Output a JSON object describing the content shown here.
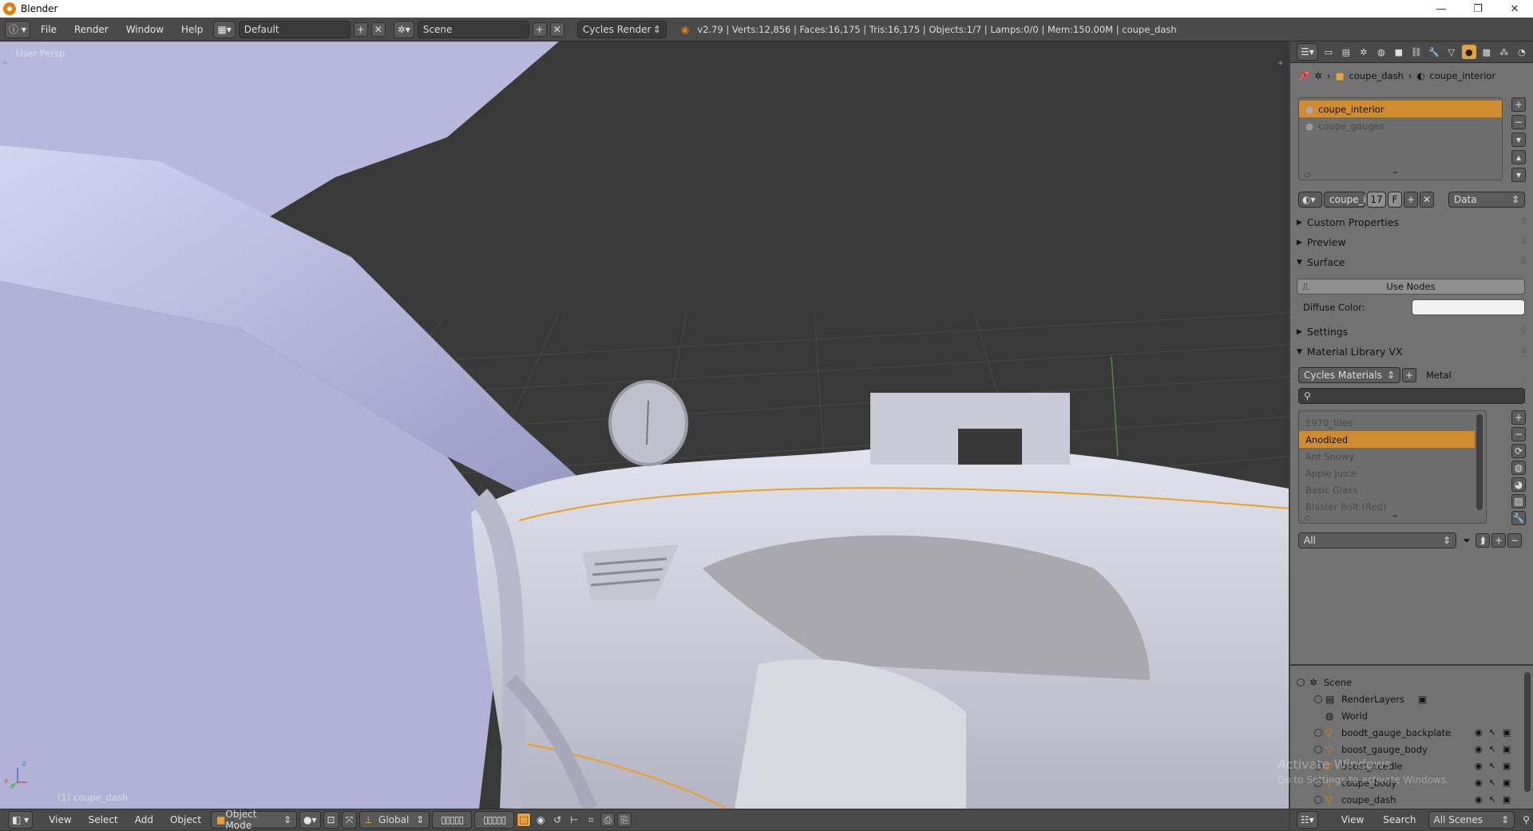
{
  "window": {
    "title": "Blender",
    "minimize": "—",
    "restore": "❐",
    "close": "✕"
  },
  "menubar": {
    "items": [
      "File",
      "Render",
      "Window",
      "Help"
    ],
    "layout": "Default",
    "scene": "Scene",
    "engine": "Cycles Render",
    "stats": "v2.79 | Verts:12,856 | Faces:16,175 | Tris:16,175 | Objects:1/7 | Lamps:0/0 | Mem:150.00M | coupe_dash"
  },
  "viewport": {
    "view_label": "User Persp",
    "object_label": "(1) coupe_dash",
    "axis_x": "x",
    "axis_y": "y",
    "axis_z": "z"
  },
  "bottombar": {
    "menus": [
      "View",
      "Select",
      "Add",
      "Object"
    ],
    "mode": "Object Mode",
    "orientation": "Global"
  },
  "properties": {
    "breadcrumb": [
      "coupe_dash",
      "coupe_interior"
    ],
    "material_slots": [
      "coupe_interior",
      "coupe_gauges"
    ],
    "material_name": "coupe_in",
    "user_count": "17",
    "fake_user": "F",
    "link": "Data",
    "panels": {
      "custom_properties": "Custom Properties",
      "preview": "Preview",
      "surface": "Surface",
      "settings": "Settings",
      "material_library": "Material Library VX"
    },
    "use_nodes": "Use Nodes",
    "diffuse_label": "Diffuse Color:",
    "library_source": "Cycles Materials",
    "library_category": "Metal",
    "library_items": [
      "1970_tiles",
      "Anodized",
      "Ant Snowy",
      "Apple Juice",
      "Basic Glass",
      "Blaster Bolt (Red)"
    ],
    "filter": "All"
  },
  "outliner": {
    "rows": [
      "Scene",
      "RenderLayers",
      "World",
      "boodt_gauge_backplate",
      "boost_gauge_body",
      "boost_needle",
      "coupe_body",
      "coupe_dash"
    ],
    "view": "View",
    "search": "Search",
    "scenes": "All Scenes"
  },
  "watermark": {
    "line1": "Activate Windows",
    "line2": "Go to Settings to activate Windows."
  },
  "colors": {
    "accent": "#e8a23c",
    "selection": "#f0a020",
    "mesh": "#c8c9e6"
  }
}
